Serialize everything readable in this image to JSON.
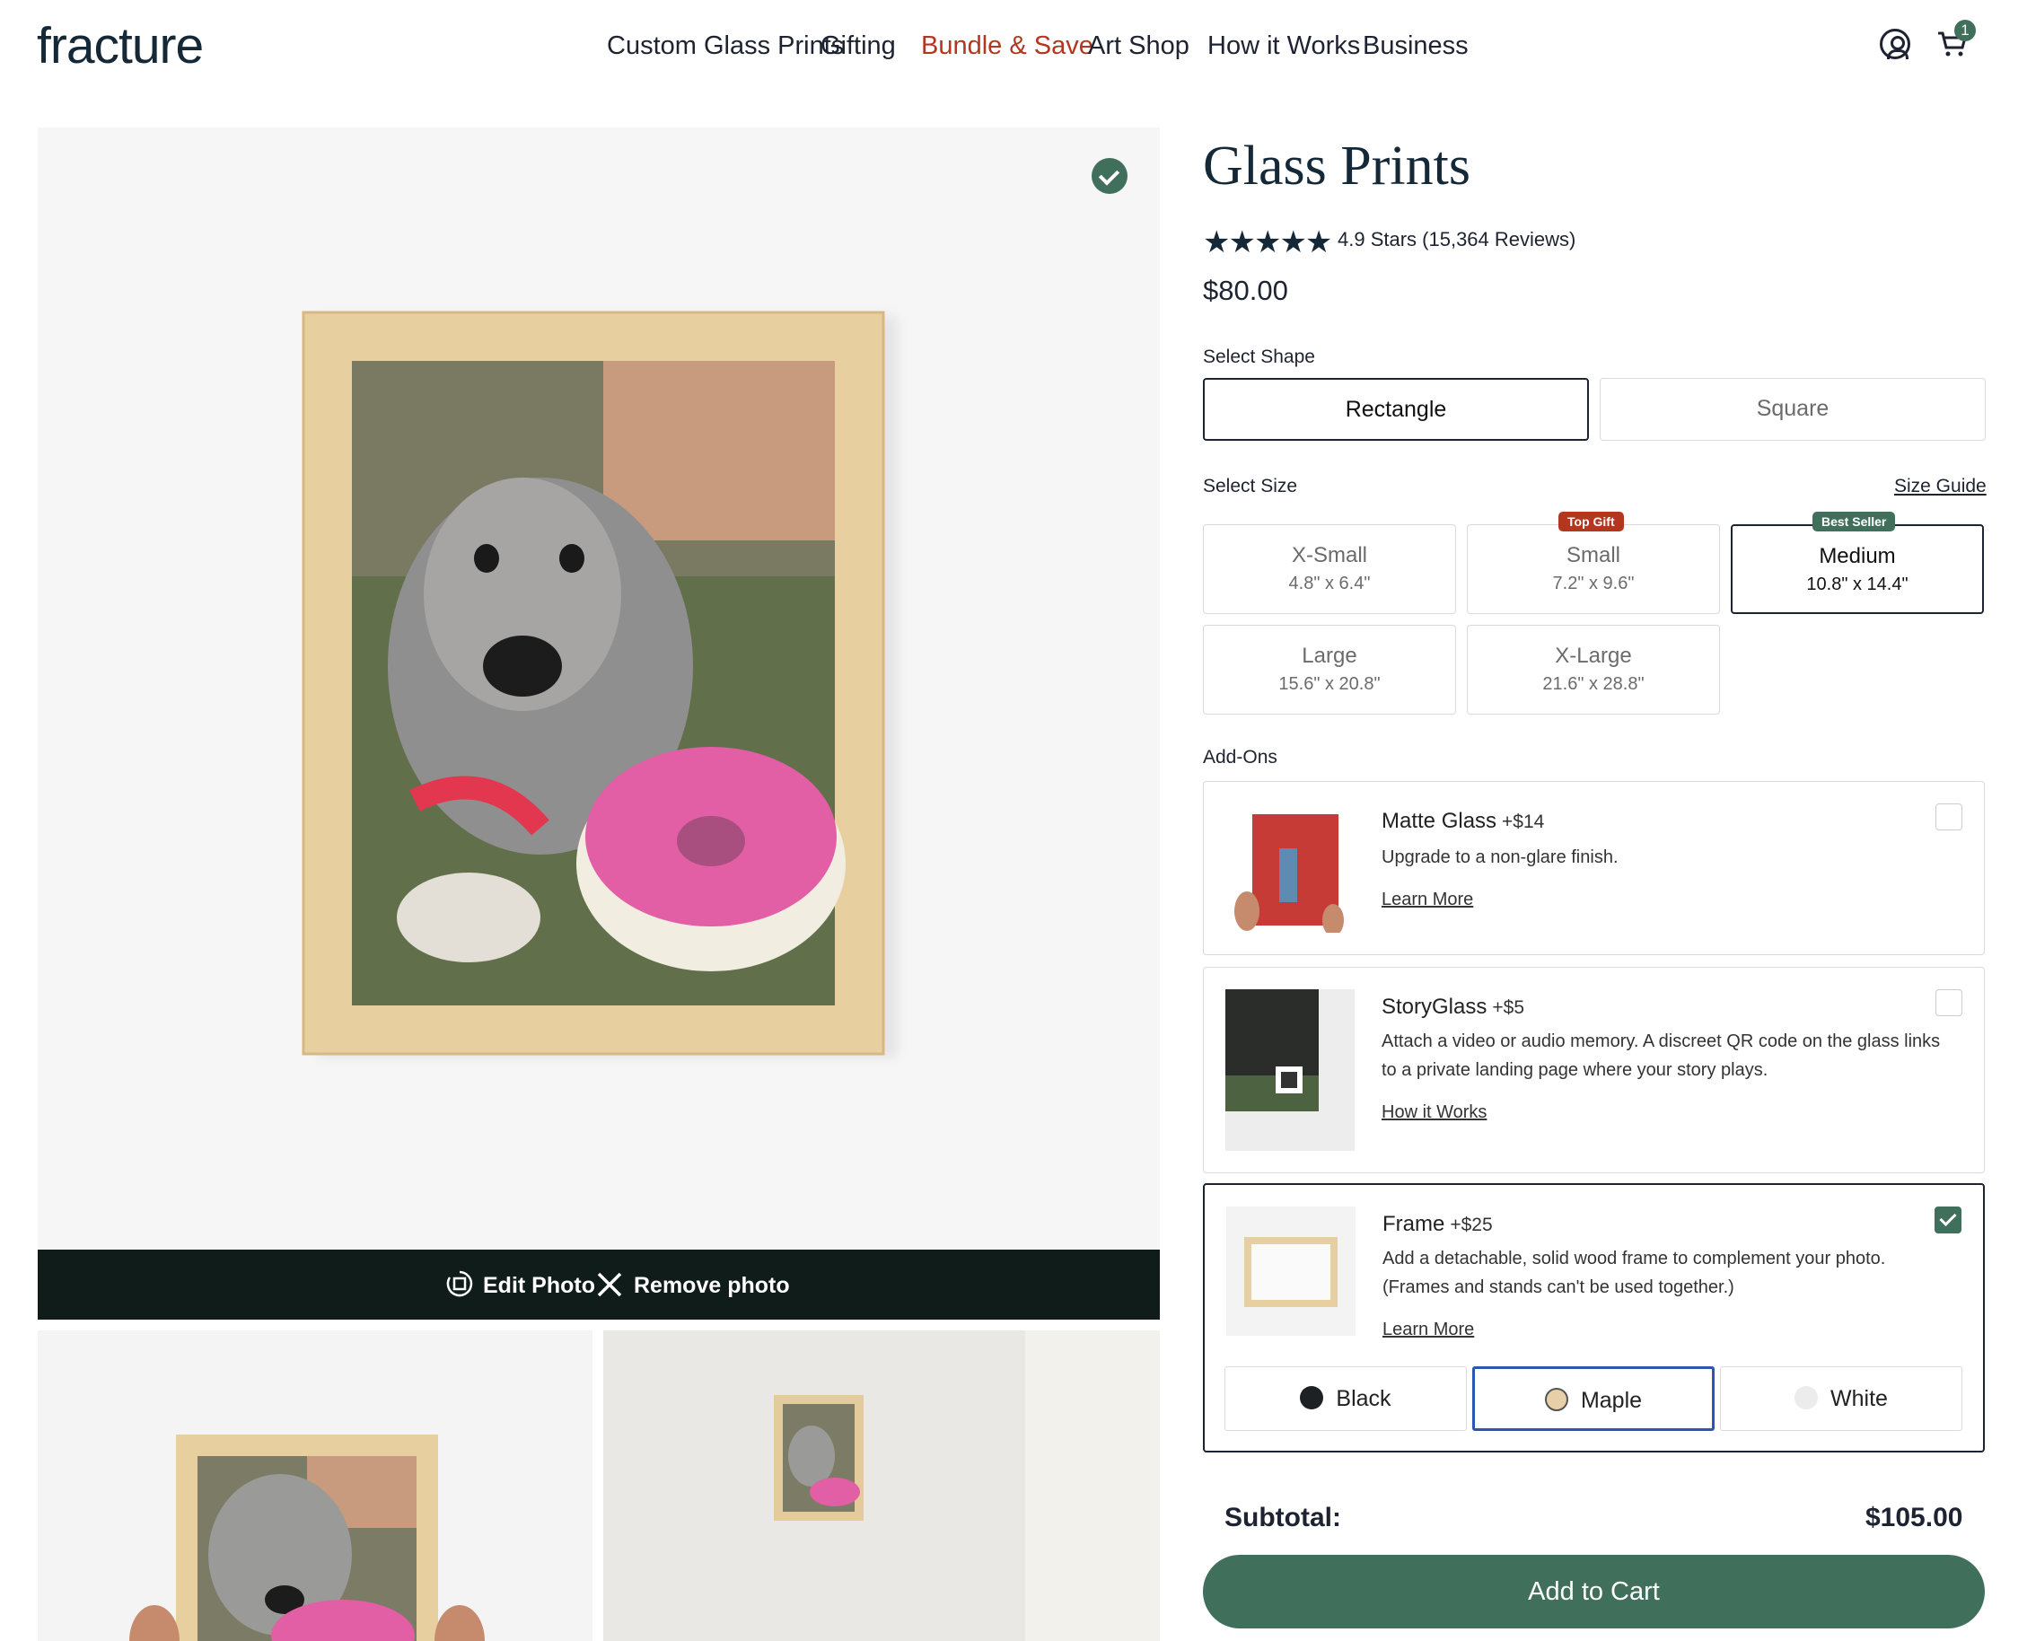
{
  "brand": {
    "logo": "fracture"
  },
  "nav": {
    "items": [
      "Custom Glass Prints",
      "Gifting",
      "Bundle & Save",
      "Art Shop",
      "How it Works",
      "Business"
    ],
    "highlight_color": "#b3361f",
    "cart_count": "1",
    "icons": [
      "account-icon",
      "cart-icon"
    ]
  },
  "gallery": {
    "edit_label": "Edit Photo",
    "remove_label": "Remove photo",
    "selected_icon": "check-icon"
  },
  "product": {
    "title": "Glass Prints",
    "stars": "★★★★★",
    "rating_text": "4.9 Stars (15,364 Reviews)",
    "price": "$80.00"
  },
  "shape": {
    "label": "Select Shape",
    "options": [
      "Rectangle",
      "Square"
    ],
    "selected": "Rectangle"
  },
  "size": {
    "label": "Select Size",
    "guide": "Size Guide",
    "options": [
      {
        "name": "X-Small",
        "dims": "4.8\" x 6.4\""
      },
      {
        "name": "Small",
        "dims": "7.2\" x 9.6\"",
        "tag": "Top Gift"
      },
      {
        "name": "Medium",
        "dims": "10.8\" x 14.4\"",
        "tag": "Best Seller"
      },
      {
        "name": "Large",
        "dims": "15.6\" x 20.8\""
      },
      {
        "name": "X-Large",
        "dims": "21.6\" x 28.8\""
      }
    ],
    "selected": "Medium",
    "tag_colors": {
      "top_gift": "#b3361f",
      "best_seller": "#40705b"
    }
  },
  "addons": {
    "label": "Add-Ons",
    "items": [
      {
        "name": "Matte Glass",
        "price": "+$14",
        "desc": "Upgrade to a non-glare finish.",
        "link": "Learn More",
        "checked": false
      },
      {
        "name": "StoryGlass",
        "price": "+$5",
        "desc": "Attach a video or audio memory.  A discreet QR code on the glass links to a private landing page where your story plays.",
        "link": "How it Works",
        "checked": false
      },
      {
        "name": "Frame",
        "price": "+$25",
        "desc": "Add a detachable, solid wood frame to complement your photo. (Frames and stands can't be used together.)",
        "link": "Learn More",
        "checked": true
      }
    ],
    "frame_colors": [
      {
        "name": "Black",
        "color": "#1e2124"
      },
      {
        "name": "Maple",
        "color": "#e7cfa8"
      },
      {
        "name": "White",
        "color": "#ececec"
      }
    ],
    "frame_selected": "Maple"
  },
  "checkout": {
    "subtotal_label": "Subtotal:",
    "subtotal_value": "$105.00",
    "add_to_cart": "Add to Cart",
    "accent": "#40705b"
  }
}
